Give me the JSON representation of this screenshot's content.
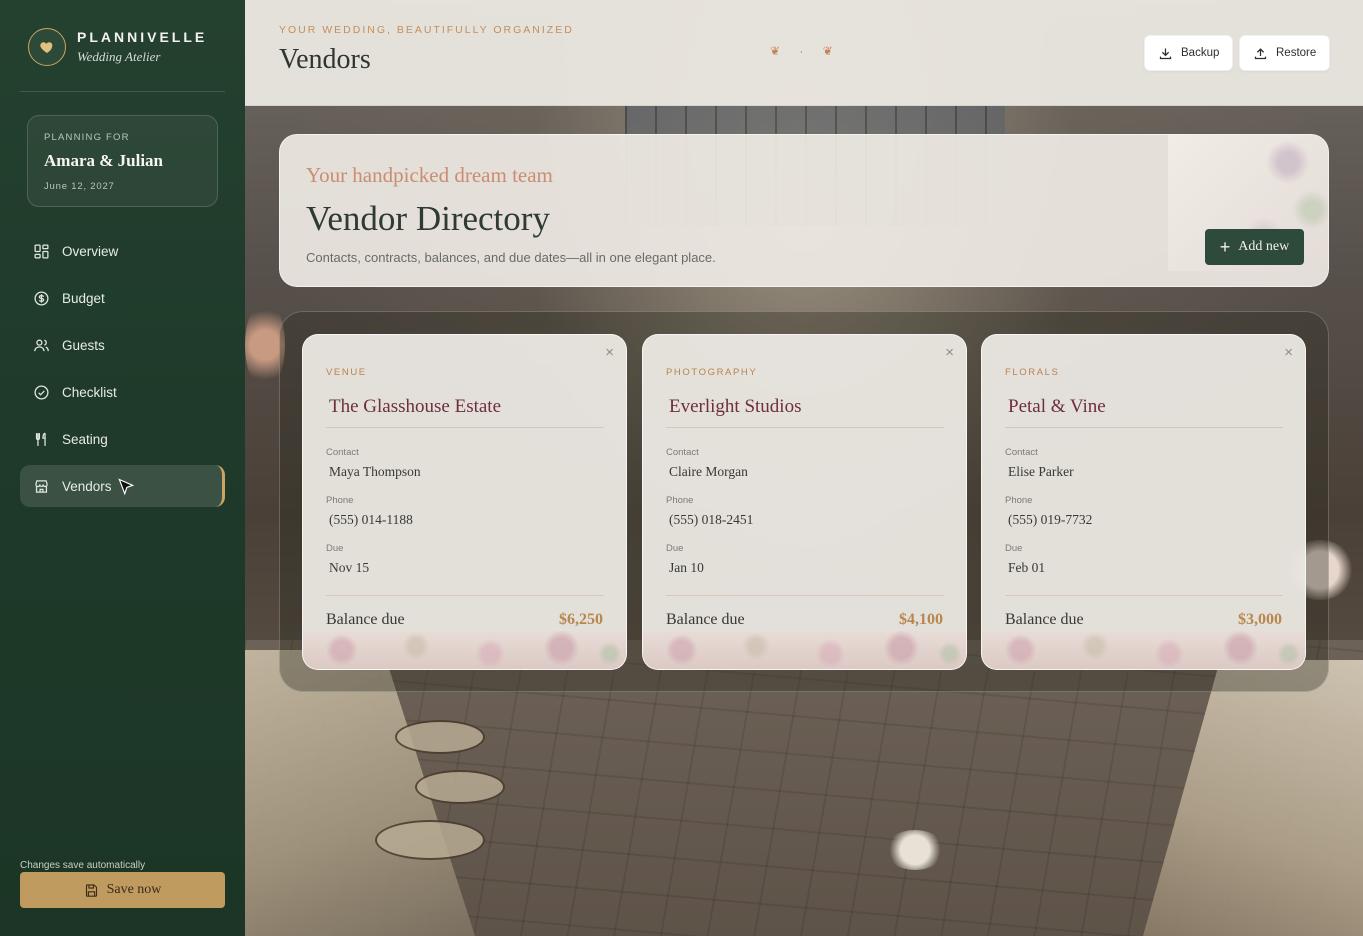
{
  "brand": {
    "name": "PLANNIVELLE",
    "subtitle": "Wedding Atelier",
    "icon": "heart-icon"
  },
  "planning": {
    "label": "PLANNING FOR",
    "names": "Amara & Julian",
    "date": "June 12, 2027"
  },
  "nav": {
    "items": [
      {
        "label": "Overview",
        "icon": "dashboard-icon"
      },
      {
        "label": "Budget",
        "icon": "dollar-icon"
      },
      {
        "label": "Guests",
        "icon": "users-icon"
      },
      {
        "label": "Checklist",
        "icon": "check-circle-icon"
      },
      {
        "label": "Seating",
        "icon": "utensils-icon"
      },
      {
        "label": "Vendors",
        "icon": "store-icon",
        "active": true
      }
    ]
  },
  "footer": {
    "autosave_note": "Changes save automatically",
    "save_label": "Save now"
  },
  "header": {
    "eyebrow": "YOUR WEDDING, BEAUTIFULLY ORGANIZED",
    "title": "Vendors",
    "ornament": "❦ · ❦",
    "backup_label": "Backup",
    "restore_label": "Restore"
  },
  "hero": {
    "kicker": "Your handpicked dream team",
    "title": "Vendor Directory",
    "description": "Contacts, contracts, balances, and due dates—all in one elegant place.",
    "add_label": "Add new"
  },
  "labels": {
    "contact": "Contact",
    "phone": "Phone",
    "due": "Due",
    "balance": "Balance due",
    "close": "×"
  },
  "vendors": [
    {
      "category": "VENUE",
      "name": "The Glasshouse Estate",
      "contact": "Maya Thompson",
      "phone": "(555) 014-1188",
      "due": "Nov 15",
      "balance": "$6,250"
    },
    {
      "category": "PHOTOGRAPHY",
      "name": "Everlight Studios",
      "contact": "Claire Morgan",
      "phone": "(555) 018-2451",
      "due": "Jan 10",
      "balance": "$4,100"
    },
    {
      "category": "FLORALS",
      "name": "Petal & Vine",
      "contact": "Elise Parker",
      "phone": "(555) 019-7732",
      "due": "Feb 01",
      "balance": "$3,000"
    }
  ],
  "colors": {
    "sidebar": "#1f3a2a",
    "accent_gold": "#c9a465",
    "vendor_name": "#6e2e3a",
    "balance": "#b8874f"
  }
}
